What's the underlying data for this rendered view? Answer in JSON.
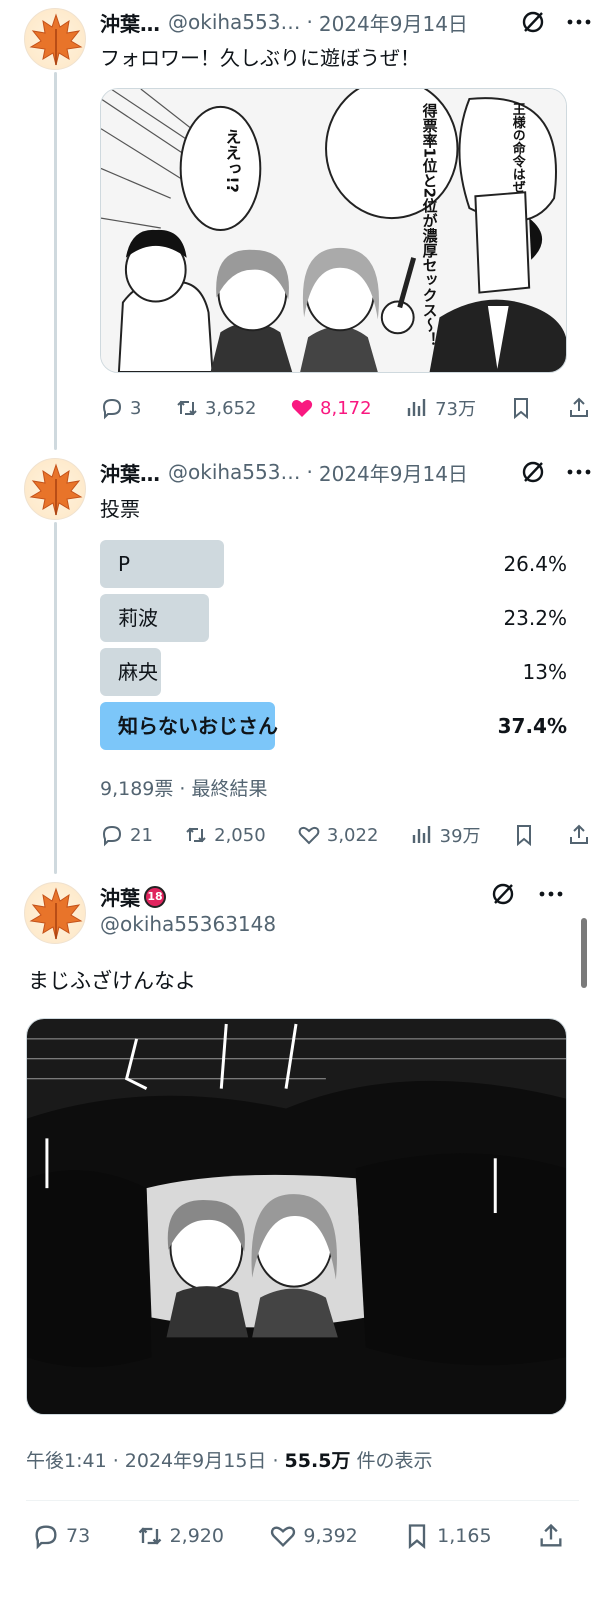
{
  "colors": {
    "accent": "#1d9bf0",
    "like": "#f91880",
    "text": "#0f1419",
    "secondary": "#536471",
    "poll_bar": "#cfd9de",
    "poll_winner": "#7cc6f9"
  },
  "tweet1": {
    "name": "沖葉…",
    "handle": "@okiha553…",
    "sep": "·",
    "date": "2024年9月14日",
    "text": "フォロワー！久しぶりに遊ぼうぜ！",
    "image_bubbles": [
      "ええっ!?",
      "得票率1位と2位が濃厚セックス〜！",
      "王様の命令はぜった〜い！"
    ],
    "actions": {
      "replies": "3",
      "retweets": "3,652",
      "likes": "8,172",
      "views": "73万"
    }
  },
  "tweet2": {
    "name": "沖葉…",
    "handle": "@okiha553…",
    "sep": "·",
    "date": "2024年9月14日",
    "text": "投票",
    "poll": {
      "options": [
        {
          "label": "P",
          "percent": "26.4%",
          "fraction": 0.264,
          "winner": false
        },
        {
          "label": "莉波",
          "percent": "23.2%",
          "fraction": 0.232,
          "winner": false
        },
        {
          "label": "麻央",
          "percent": "13%",
          "fraction": 0.13,
          "winner": false
        },
        {
          "label": "知らないおじさん",
          "percent": "37.4%",
          "fraction": 0.374,
          "winner": true
        }
      ],
      "meta": "9,189票 · 最終結果"
    },
    "actions": {
      "replies": "21",
      "retweets": "2,050",
      "likes": "3,022",
      "views": "39万"
    }
  },
  "main": {
    "name": "沖葉",
    "badge": "18",
    "handle": "@okiha55363148",
    "text": "まじふざけんなよ",
    "meta_prefix": "午後1:41 · 2024年9月15日 · ",
    "meta_views": "55.5万",
    "meta_suffix": " 件の表示",
    "actions": {
      "replies": "73",
      "retweets": "2,920",
      "likes": "9,392",
      "bookmarks": "1,165"
    }
  }
}
